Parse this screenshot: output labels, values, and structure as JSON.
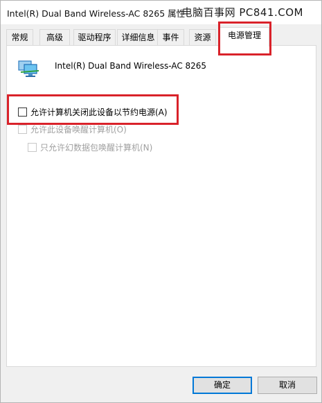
{
  "window": {
    "title": "Intel(R) Dual Band Wireless-AC 8265 属性",
    "watermark": "电脑百事网 PC841.COM"
  },
  "tabs": [
    {
      "label": "常规",
      "active": false
    },
    {
      "label": "高级",
      "active": false
    },
    {
      "label": "驱动程序",
      "active": false
    },
    {
      "label": "详细信息",
      "active": false
    },
    {
      "label": "事件",
      "active": false
    },
    {
      "label": "资源",
      "active": false
    },
    {
      "label": "电源管理",
      "active": true
    }
  ],
  "device": {
    "icon": "network-adapter-icon",
    "name": "Intel(R) Dual Band Wireless-AC 8265"
  },
  "options": [
    {
      "label": "允许计算机关闭此设备以节约电源(A)",
      "checked": false,
      "enabled": true
    },
    {
      "label": "允许此设备唤醒计算机(O)",
      "checked": false,
      "enabled": false
    },
    {
      "label": "只允许幻数据包唤醒计算机(N)",
      "checked": false,
      "enabled": false
    }
  ],
  "buttons": {
    "ok": "确定",
    "cancel": "取消"
  },
  "colors": {
    "annotation": "#d9222a",
    "focus": "#0078d7"
  }
}
